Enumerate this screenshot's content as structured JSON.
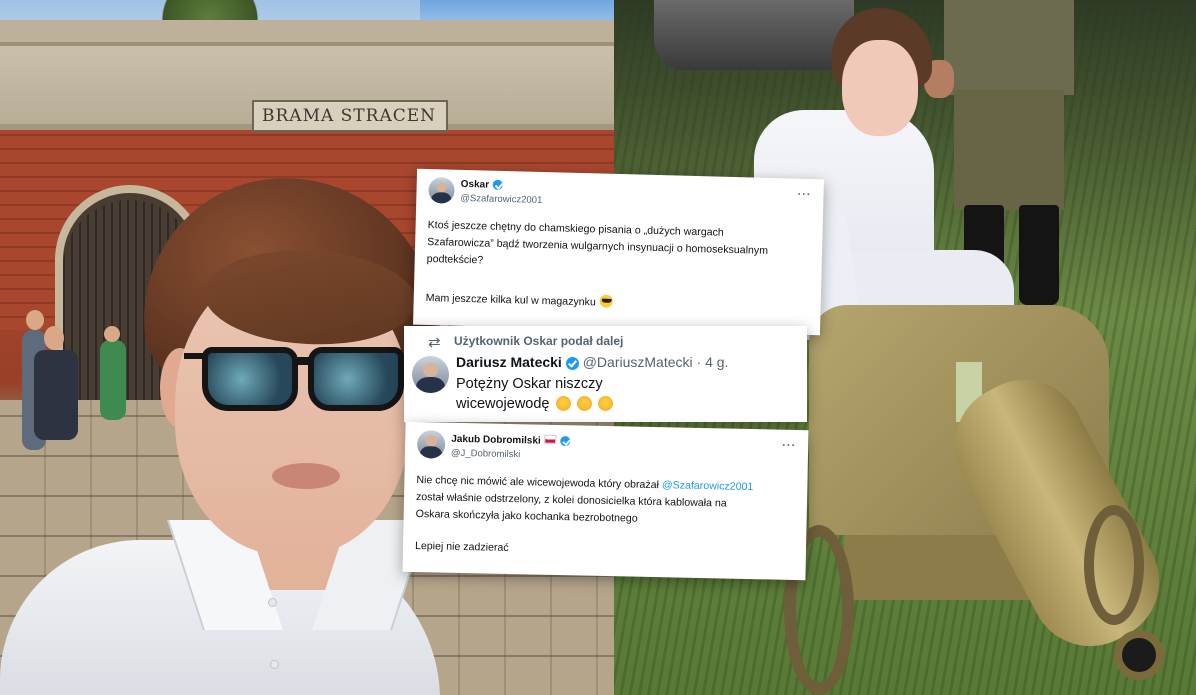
{
  "photo_left": {
    "gate_sign": "BRAMA STRACEN"
  },
  "tweet1": {
    "name": "Oskar",
    "handle": "@Szafarowicz2001",
    "verified": true,
    "menu_icon": "more-icon",
    "lines": [
      "Ktoś jeszcze chętny do chamskiego pisania o „dużych wargach",
      "Szafarowicza” bądź tworzenia wulgarnych insynuacji o homoseksualnym",
      "podtekście?"
    ],
    "last_line": "Mam jeszcze kilka kul w magazynku",
    "emoji": "smiling-face-with-sunglasses-icon"
  },
  "tweet2": {
    "retweet_label": "Użytkownik Oskar podał dalej",
    "retweet_icon": "retweet-icon",
    "name": "Dariusz Matecki",
    "handle": "@DariuszMatecki",
    "separator": "·",
    "time": "4 g.",
    "verified": true,
    "line1": "Potężny Oskar niszczy",
    "line2": "wicewojewodę",
    "emoji": "slightly-smiling-face-icon"
  },
  "tweet3": {
    "name": "Jakub Dobromilski",
    "handle": "@J_Dobromilski",
    "flag": "poland-flag-icon",
    "verified": true,
    "menu_icon": "more-icon",
    "line1_before": "Nie chcę nic mówić ale wicewojewoda który obrażał",
    "line1_mention": "@Szafarowicz2001",
    "line2": "został właśnie odstrzelony, z kolei donosicielka która kablowała na",
    "line3": "Oskara skończyła jako kochanka bezrobotnego",
    "line4": "Lepiej nie zadzierać"
  },
  "colors": {
    "verified": "#1d9bf0",
    "mention": "#1d9bf0",
    "muted": "#536471"
  }
}
